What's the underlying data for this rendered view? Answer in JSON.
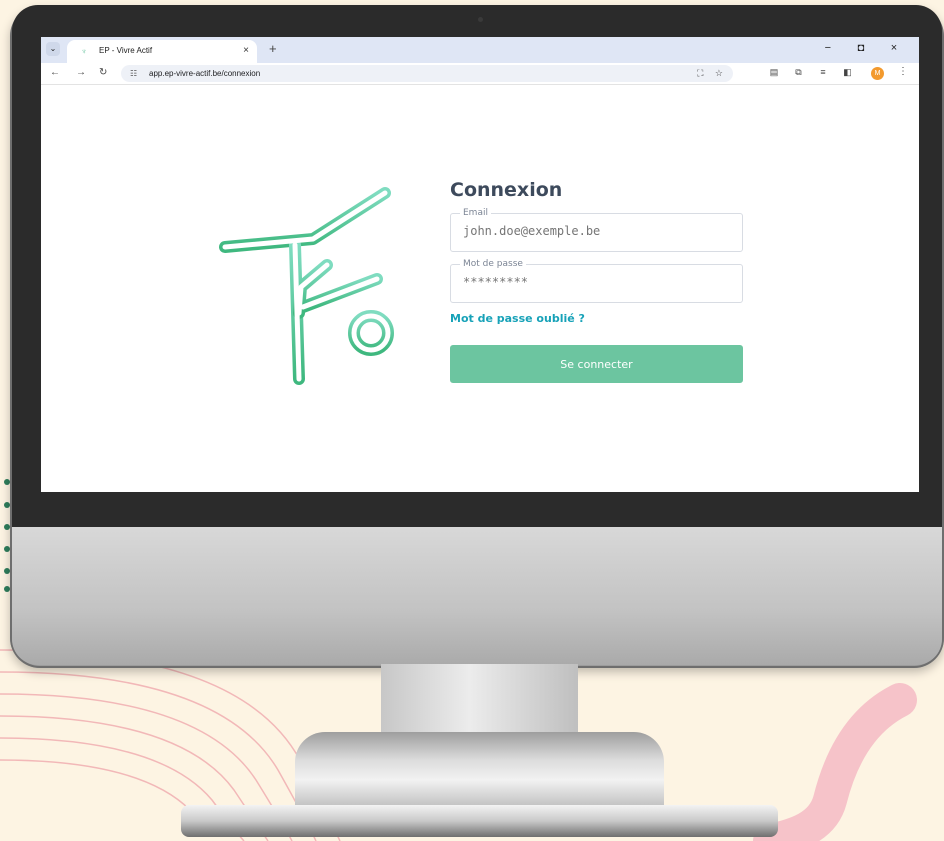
{
  "browser": {
    "tab": {
      "title": "EP - Vivre Actif",
      "close": "×"
    },
    "new_tab": "+",
    "window_controls": [
      "−",
      "◘",
      "×"
    ],
    "address": {
      "url": "app.ep-vivre-actif.be/connexion"
    }
  },
  "login": {
    "title": "Connexion",
    "email": {
      "label": "Email",
      "placeholder": "john.doe@exemple.be"
    },
    "password": {
      "label": "Mot de passe",
      "placeholder": "*********"
    },
    "forgot_link": "Mot de passe oublié ?",
    "submit_label": "Se connecter"
  },
  "colors": {
    "brand_green": "#6cc5a0",
    "link_teal": "#17a2b8",
    "title_slate": "#3d4a5c",
    "background": "#fdf4e3"
  },
  "icons": [
    "tab-menu-icon",
    "favicon-icon",
    "back-icon",
    "forward-icon",
    "reload-icon",
    "site-info-icon",
    "translate-icon",
    "star-icon",
    "reading-list-icon",
    "extensions-icon",
    "media-icon",
    "side-panel-icon",
    "avatar-icon",
    "more-icon"
  ]
}
